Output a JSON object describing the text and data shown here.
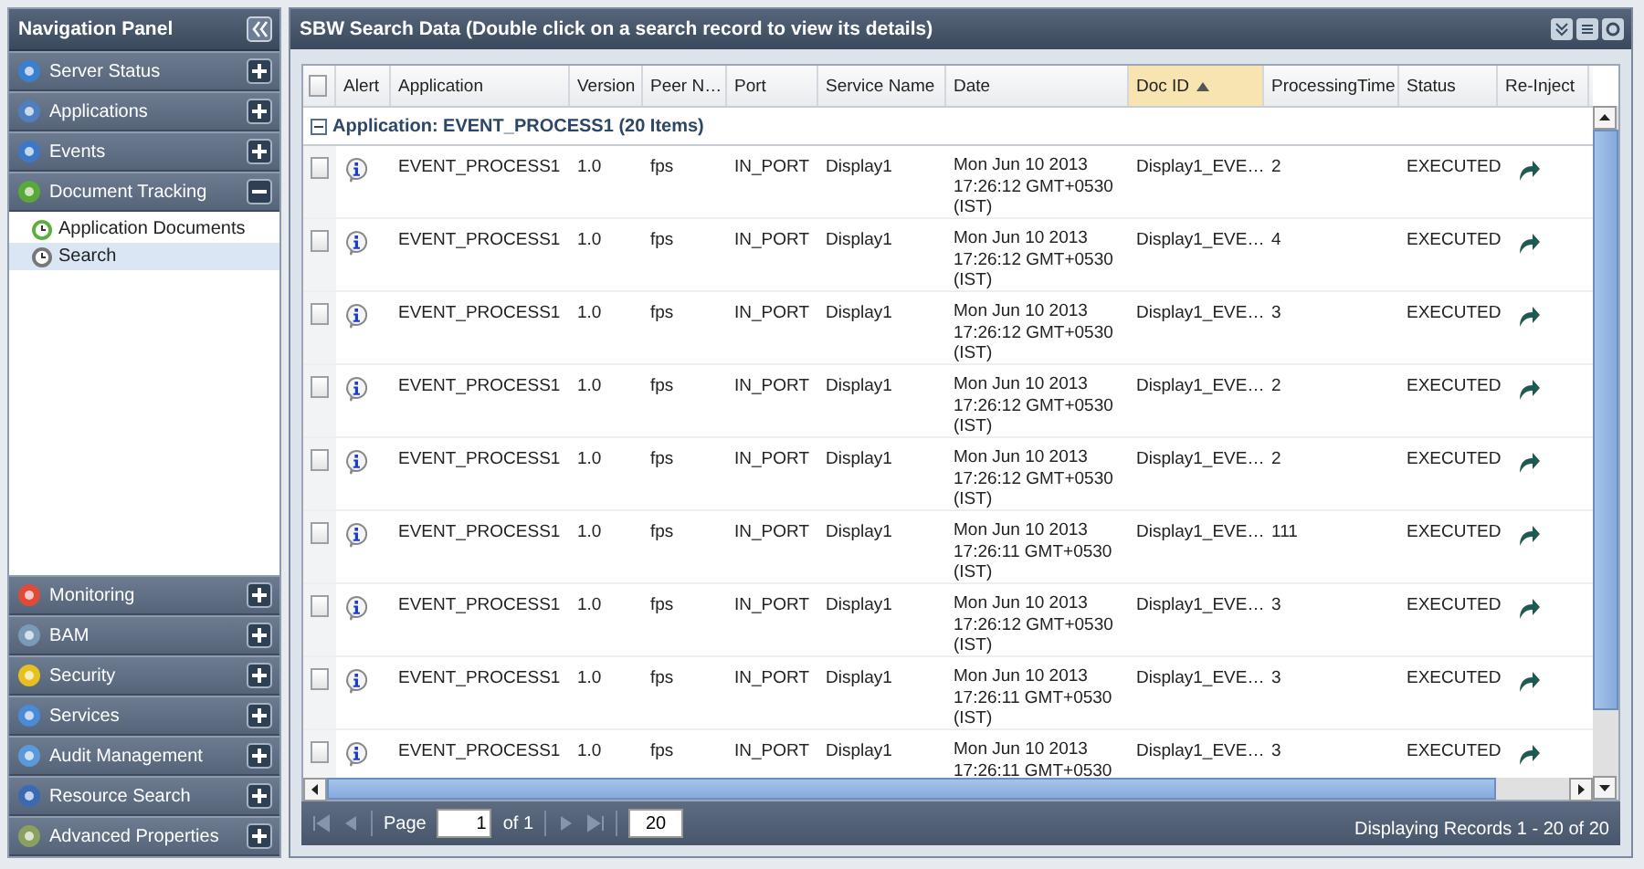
{
  "navigation": {
    "title": "Navigation Panel",
    "items": [
      {
        "label": "Server Status",
        "expanded": false
      },
      {
        "label": "Applications",
        "expanded": false
      },
      {
        "label": "Events",
        "expanded": false
      },
      {
        "label": "Document Tracking",
        "expanded": true,
        "children": [
          {
            "label": "Application Documents",
            "selected": false
          },
          {
            "label": "Search",
            "selected": true
          }
        ]
      }
    ],
    "bottom_items": [
      {
        "label": "Monitoring",
        "expanded": false
      },
      {
        "label": "BAM",
        "expanded": false
      },
      {
        "label": "Security",
        "expanded": false
      },
      {
        "label": "Services",
        "expanded": false
      },
      {
        "label": "Audit Management",
        "expanded": false
      },
      {
        "label": "Resource Search",
        "expanded": false
      },
      {
        "label": "Advanced Properties",
        "expanded": false
      }
    ]
  },
  "panel": {
    "title": "SBW Search Data (Double click on a search record to view its details)",
    "table": {
      "select_all_checked": false,
      "columns": [
        {
          "label": "Alert",
          "sorted": false
        },
        {
          "label": "Application",
          "sorted": false
        },
        {
          "label": "Version",
          "sorted": false
        },
        {
          "label": "Peer N…",
          "sorted": false
        },
        {
          "label": "Port",
          "sorted": false
        },
        {
          "label": "Service Name",
          "sorted": false
        },
        {
          "label": "Date",
          "sorted": false
        },
        {
          "label": "Doc ID",
          "sorted": true
        },
        {
          "label": "ProcessingTime",
          "sorted": false
        },
        {
          "label": "Status",
          "sorted": false
        },
        {
          "label": "Re-Inject",
          "sorted": false
        }
      ],
      "group": {
        "label": "Application: EVENT_PROCESS1 (20 Items)",
        "expanded": true
      },
      "rows": [
        {
          "checked": false,
          "cells": [
            "",
            "EVENT_PROCESS1",
            "1.0",
            "fps",
            "IN_PORT",
            "Display1",
            [
              "Mon Jun 10 2013",
              "17:26:12 GMT+0530",
              "(IST)"
            ],
            "Display1_EVE…",
            "2",
            "EXECUTED"
          ]
        },
        {
          "checked": false,
          "cells": [
            "",
            "EVENT_PROCESS1",
            "1.0",
            "fps",
            "IN_PORT",
            "Display1",
            [
              "Mon Jun 10 2013",
              "17:26:12 GMT+0530",
              "(IST)"
            ],
            "Display1_EVE…",
            "4",
            "EXECUTED"
          ]
        },
        {
          "checked": false,
          "cells": [
            "",
            "EVENT_PROCESS1",
            "1.0",
            "fps",
            "IN_PORT",
            "Display1",
            [
              "Mon Jun 10 2013",
              "17:26:12 GMT+0530",
              "(IST)"
            ],
            "Display1_EVE…",
            "3",
            "EXECUTED"
          ]
        },
        {
          "checked": false,
          "cells": [
            "",
            "EVENT_PROCESS1",
            "1.0",
            "fps",
            "IN_PORT",
            "Display1",
            [
              "Mon Jun 10 2013",
              "17:26:12 GMT+0530",
              "(IST)"
            ],
            "Display1_EVE…",
            "2",
            "EXECUTED"
          ]
        },
        {
          "checked": false,
          "cells": [
            "",
            "EVENT_PROCESS1",
            "1.0",
            "fps",
            "IN_PORT",
            "Display1",
            [
              "Mon Jun 10 2013",
              "17:26:12 GMT+0530",
              "(IST)"
            ],
            "Display1_EVE…",
            "2",
            "EXECUTED"
          ]
        },
        {
          "checked": false,
          "cells": [
            "",
            "EVENT_PROCESS1",
            "1.0",
            "fps",
            "IN_PORT",
            "Display1",
            [
              "Mon Jun 10 2013",
              "17:26:11 GMT+0530",
              "(IST)"
            ],
            "Display1_EVE…",
            "111",
            "EXECUTED"
          ]
        },
        {
          "checked": false,
          "cells": [
            "",
            "EVENT_PROCESS1",
            "1.0",
            "fps",
            "IN_PORT",
            "Display1",
            [
              "Mon Jun 10 2013",
              "17:26:12 GMT+0530",
              "(IST)"
            ],
            "Display1_EVE…",
            "3",
            "EXECUTED"
          ]
        },
        {
          "checked": false,
          "cells": [
            "",
            "EVENT_PROCESS1",
            "1.0",
            "fps",
            "IN_PORT",
            "Display1",
            [
              "Mon Jun 10 2013",
              "17:26:11 GMT+0530",
              "(IST)"
            ],
            "Display1_EVE…",
            "3",
            "EXECUTED"
          ]
        },
        {
          "checked": false,
          "cells": [
            "",
            "EVENT_PROCESS1",
            "1.0",
            "fps",
            "IN_PORT",
            "Display1",
            [
              "Mon Jun 10 2013",
              "17:26:11 GMT+0530"
            ],
            "Display1_EVE…",
            "3",
            "EXECUTED"
          ]
        }
      ]
    },
    "pager": {
      "page_label": "Page",
      "page": "1",
      "of_label": "of 1",
      "page_size": "20",
      "status": "Displaying Records 1 - 20 of 20"
    }
  }
}
